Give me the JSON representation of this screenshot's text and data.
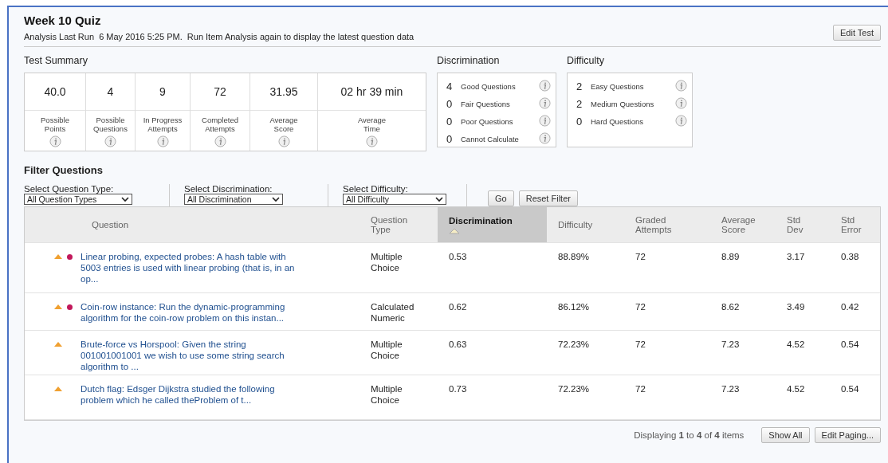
{
  "title": "Week 10 Quiz",
  "subtitle": "Analysis Last Run  6 May 2016 5:25 PM.  Run Item Analysis again to display the latest question data",
  "edit_test_button": "Edit Test",
  "test_summary": {
    "heading": "Test Summary",
    "stats": [
      {
        "value": "40.0",
        "label": "Possible Points"
      },
      {
        "value": "4",
        "label": "Possible Questions"
      },
      {
        "value": "9",
        "label": "In Progress Attempts"
      },
      {
        "value": "72",
        "label": "Completed Attempts"
      },
      {
        "value": "31.95",
        "label": "Average Score"
      },
      {
        "value": "02 hr 39 min",
        "label": "Average Time"
      }
    ]
  },
  "discrimination": {
    "heading": "Discrimination",
    "items": [
      {
        "count": "4",
        "label": "Good Questions"
      },
      {
        "count": "0",
        "label": "Fair Questions"
      },
      {
        "count": "0",
        "label": "Poor Questions"
      },
      {
        "count": "0",
        "label": "Cannot Calculate"
      }
    ]
  },
  "difficulty": {
    "heading": "Difficulty",
    "items": [
      {
        "count": "2",
        "label": "Easy Questions"
      },
      {
        "count": "2",
        "label": "Medium Questions"
      },
      {
        "count": "0",
        "label": "Hard Questions"
      }
    ]
  },
  "filter": {
    "heading": "Filter Questions",
    "selects": [
      {
        "label": "Select Question Type:",
        "value": "All Question Types"
      },
      {
        "label": "Select Discrimination:",
        "value": "All Discrimination"
      },
      {
        "label": "Select Difficulty:",
        "value": "All Difficulty"
      }
    ],
    "buttons": [
      "Go",
      "Reset Filter"
    ]
  },
  "table": {
    "columns": [
      {
        "label": "Question",
        "sorted": false
      },
      {
        "label": "Question Type",
        "sorted": false
      },
      {
        "label": "Discrimination",
        "sorted": true
      },
      {
        "label": "Difficulty",
        "sorted": false
      },
      {
        "label": "Graded Attempts",
        "sorted": false
      },
      {
        "label": "Average Score",
        "sorted": false
      },
      {
        "label": "Std Dev",
        "sorted": false
      },
      {
        "label": "Std Error",
        "sorted": false
      }
    ],
    "rows": [
      {
        "triangle_flag": true,
        "dot_flag": true,
        "question": "Linear probing, expected probes: A hash table with 5003 entries is used with linear probing (that is, in an op...",
        "type": "Multiple Choice",
        "discrimination": "0.53",
        "difficulty": "88.89%",
        "graded": "72",
        "average": "8.89",
        "std_dev": "3.17",
        "std_error": "0.38"
      },
      {
        "triangle_flag": true,
        "dot_flag": true,
        "question": "Coin-row instance: Run the dynamic-programming algorithm for the coin-row problem on this instan...",
        "type": "Calculated Numeric",
        "discrimination": "0.62",
        "difficulty": "86.12%",
        "graded": "72",
        "average": "8.62",
        "std_dev": "3.49",
        "std_error": "0.42"
      },
      {
        "triangle_flag": true,
        "dot_flag": false,
        "question": "Brute-force vs Horspool: Given the string 001001001001 we wish to use some string search algorithm to ...",
        "type": "Multiple Choice",
        "discrimination": "0.63",
        "difficulty": "72.23%",
        "graded": "72",
        "average": "7.23",
        "std_dev": "4.52",
        "std_error": "0.54"
      },
      {
        "triangle_flag": true,
        "dot_flag": false,
        "question": "Dutch flag: Edsger Dijkstra studied the following problem which he called theProblem of t...",
        "type": "Multiple Choice",
        "discrimination": "0.73",
        "difficulty": "72.23%",
        "graded": "72",
        "average": "7.23",
        "std_dev": "4.52",
        "std_error": "0.54"
      }
    ]
  },
  "footer": {
    "status": "Displaying **1** to **4** of **4** items",
    "buttons": [
      "Show All",
      "Edit Paging..."
    ]
  }
}
